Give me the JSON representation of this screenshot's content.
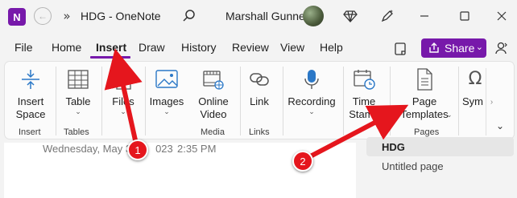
{
  "titlebar": {
    "app_icon": "onenote-icon",
    "back_icon": "back-arrow-icon",
    "overflow": "»",
    "title": "HDG - OneNote",
    "user_name": "Marshall Gunnell",
    "minimize_icon": "minimize-icon",
    "maximize_icon": "maximize-icon",
    "close_icon": "close-icon"
  },
  "tabs": [
    {
      "label": "File"
    },
    {
      "label": "Home"
    },
    {
      "label": "Insert",
      "active": true
    },
    {
      "label": "Draw"
    },
    {
      "label": "History"
    },
    {
      "label": "Review"
    },
    {
      "label": "View"
    },
    {
      "label": "Help"
    }
  ],
  "share": {
    "label": "Share",
    "chevron": "⌄"
  },
  "ribbon": {
    "insert_space": {
      "line1": "Insert",
      "line2": "Space"
    },
    "table": {
      "label": "Table",
      "caret": "⌄"
    },
    "files": {
      "label": "Files",
      "caret": "⌄"
    },
    "images": {
      "label": "Images",
      "caret": "⌄"
    },
    "online_video": {
      "line1": "Online",
      "line2": "Video"
    },
    "link": {
      "label": "Link"
    },
    "recording": {
      "label": "Recording",
      "caret": "⌄"
    },
    "time_stamp": {
      "line1": "Time",
      "line2": "Stamp",
      "caret": "⌄"
    },
    "page_templates": {
      "line1": "Page",
      "line2": "Templates",
      "caret": "⌄"
    },
    "symbols": {
      "label": "Sym"
    },
    "groups": {
      "insert": "Insert",
      "tables": "Tables",
      "media": "Media",
      "links": "Links",
      "pages": "Pages"
    },
    "scroll_right": "›",
    "collapse": "⌄"
  },
  "page": {
    "date": "Wednesday, May 3",
    "date_suffix": "023",
    "time": "2:35 PM"
  },
  "pages_panel": {
    "items": [
      {
        "label": "HDG",
        "selected": true
      },
      {
        "label": "Untitled page"
      }
    ]
  },
  "annotations": [
    {
      "number": "1"
    },
    {
      "number": "2"
    }
  ],
  "colors": {
    "accent": "#7719aa",
    "annotation_red": "#e5161d"
  }
}
